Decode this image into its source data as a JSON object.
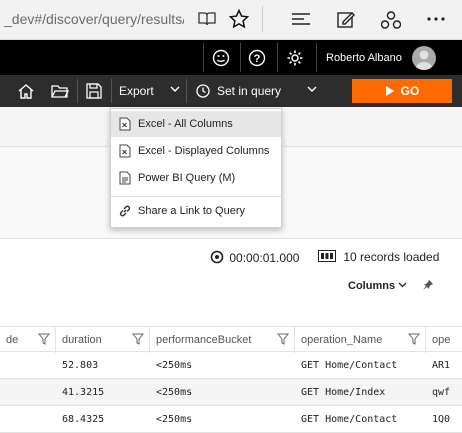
{
  "browser": {
    "url": "_dev#/discover/query/results/t",
    "icons": [
      "reading-view-icon",
      "favorite-star-icon",
      "hub-icon",
      "web-note-icon",
      "share-icon",
      "more-icon"
    ]
  },
  "header": {
    "user_name": "Roberto Albano",
    "icons": [
      "smiley-icon",
      "help-icon",
      "settings-icon"
    ]
  },
  "toolbar": {
    "export_label": "Export",
    "set_in_query_label": "Set in query",
    "go_label": "GO",
    "icons": [
      "home-icon",
      "open-folder-icon",
      "save-icon",
      "clock-icon"
    ],
    "accent_color": "#ff6a00"
  },
  "export_menu": {
    "items": [
      {
        "label": "Excel - All Columns",
        "icon": "excel-icon",
        "selected": true
      },
      {
        "label": "Excel - Displayed Columns",
        "icon": "excel-icon",
        "selected": false
      },
      {
        "label": "Power BI Query (M)",
        "icon": "document-icon",
        "selected": false
      },
      {
        "label": "Share a Link to Query",
        "icon": "link-icon",
        "selected": false
      }
    ]
  },
  "results": {
    "duration": "00:00:01.000",
    "records": "10 records loaded",
    "columns_label": "Columns"
  },
  "table": {
    "headers": [
      "de",
      "duration",
      "performanceBucket",
      "operation_Name",
      "ope"
    ],
    "rows": [
      [
        "",
        "52.803",
        "<250ms",
        "GET Home/Contact",
        "AR1"
      ],
      [
        "",
        "41.3215",
        "<250ms",
        "GET Home/Index",
        "qwf"
      ],
      [
        "",
        "68.4325",
        "<250ms",
        "GET Home/Contact",
        "1Q0"
      ]
    ]
  }
}
